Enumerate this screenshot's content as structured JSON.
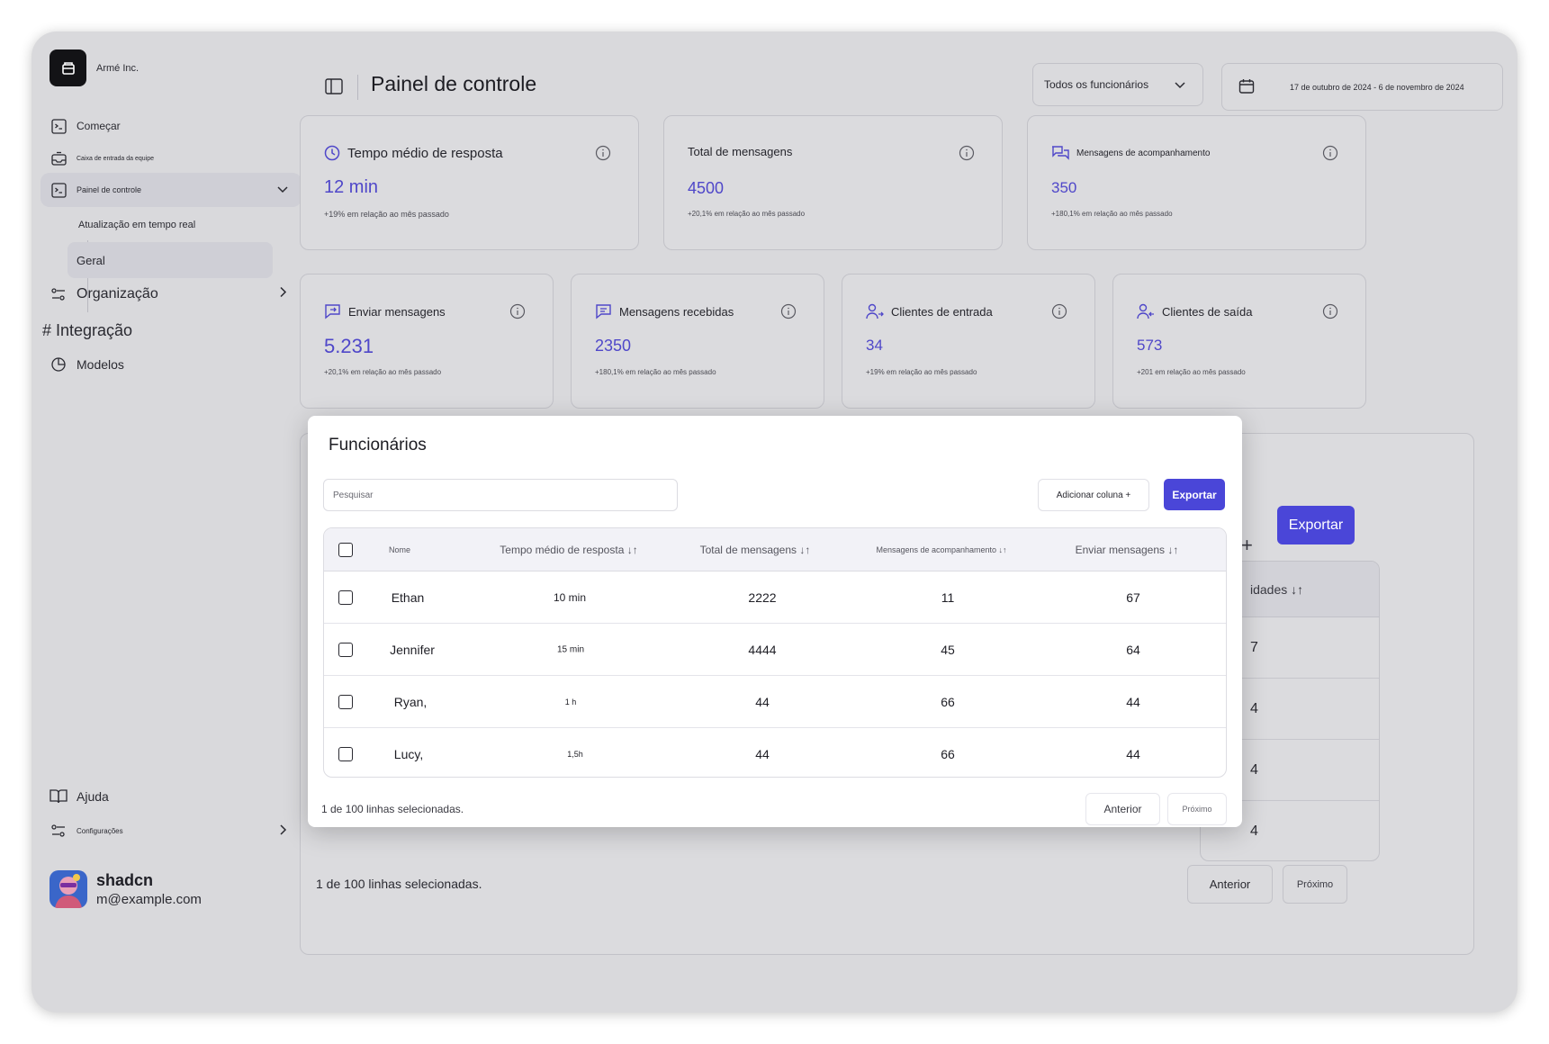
{
  "brand": {
    "name": "Armé Inc."
  },
  "sidebar": {
    "items": [
      {
        "label": "Começar",
        "icon": "terminal-icon"
      },
      {
        "label": "Caixa de entrada da equipe",
        "icon": "inbox-icon"
      },
      {
        "label": "Painel de controle",
        "icon": "terminal-icon"
      },
      {
        "label": "Organização",
        "icon": "sliders-icon"
      },
      {
        "label": "# Integração"
      },
      {
        "label": "Modelos",
        "icon": "pie-chart-icon"
      }
    ],
    "subitems": [
      {
        "label": "Atualização em tempo real"
      },
      {
        "label": "Geral"
      }
    ],
    "bottom": [
      {
        "label": "Ajuda",
        "icon": "book-icon"
      },
      {
        "label": "Configurações",
        "icon": "sliders-icon"
      }
    ]
  },
  "user": {
    "name": "shadcn",
    "email": "m@example.com"
  },
  "header": {
    "title": "Painel de controle",
    "filter": "Todos os funcionários",
    "date_range": "17 de outubro de 2024 - 6 de novembro de 2024"
  },
  "stats_top": [
    {
      "title": "Tempo médio de resposta",
      "icon": "clock-icon",
      "value": "12 min",
      "change": "+19% em relação ao mês passado"
    },
    {
      "title": "Total de mensagens",
      "value": "4500",
      "change": "+20,1% em relação ao mês passado"
    },
    {
      "title": "Mensagens de acompanhamento",
      "icon": "chat-bubbles-icon",
      "value": "350",
      "change": "+180,1% em relação ao mês passado"
    }
  ],
  "stats_bottom": [
    {
      "title": "Enviar mensagens",
      "icon": "message-send-icon",
      "value": "5.231",
      "change": "+20,1% em relação ao mês passado"
    },
    {
      "title": "Mensagens recebidas",
      "icon": "message-icon",
      "value": "2350",
      "change": "+180,1% em relação ao mês passado"
    },
    {
      "title": "Clientes de entrada",
      "icon": "user-in-icon",
      "value": "34",
      "change": "+19% em relação ao mês passado"
    },
    {
      "title": "Clientes de saída",
      "icon": "user-out-icon",
      "value": "573",
      "change": "+201 em relação ao mês passado"
    }
  ],
  "background_table": {
    "column": "idades ↓↑",
    "cells": [
      "7",
      "4",
      "4",
      "4"
    ],
    "export": "Exportar",
    "plus": "+",
    "footer": "1 de 100 linhas selecionadas.",
    "prev": "Anterior",
    "next": "Próximo"
  },
  "modal": {
    "title": "Funcionários",
    "search_placeholder": "Pesquisar",
    "add_column": "Adicionar coluna +",
    "export": "Exportar",
    "columns": [
      "Nome",
      "Tempo médio de resposta ↓↑",
      "Total de mensagens ↓↑",
      "Mensagens de acompanhamento ↓↑",
      "Enviar mensagens ↓↑"
    ],
    "rows": [
      {
        "name": "Ethan",
        "time": "10 min",
        "total": "2222",
        "follow": "11",
        "sent": "67"
      },
      {
        "name": "Jennifer",
        "time": "15 min",
        "total": "4444",
        "follow": "45",
        "sent": "64"
      },
      {
        "name": "Ryan,",
        "time": "1 h",
        "total": "44",
        "follow": "66",
        "sent": "44"
      },
      {
        "name": "Lucy,",
        "time": "1,5h",
        "total": "44",
        "follow": "66",
        "sent": "44"
      }
    ],
    "footer": "1 de 100 linhas selecionadas.",
    "prev": "Anterior",
    "next": "Próximo"
  },
  "colors": {
    "accent": "#4a46d8",
    "value": "#4f47c9",
    "background": "#d9d9dc"
  }
}
